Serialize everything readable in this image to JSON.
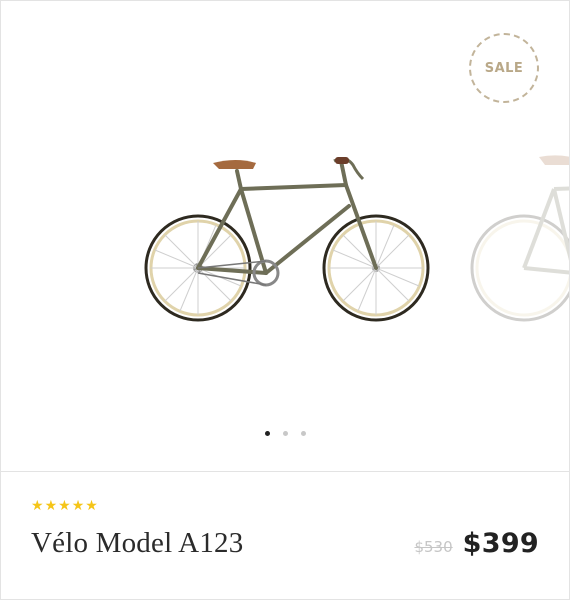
{
  "product": {
    "badge": "SALE",
    "rating_stars": [
      "★",
      "★",
      "★",
      "★",
      "★"
    ],
    "rating_value": 5,
    "name": "Vélo Model A123",
    "old_price": "$530",
    "price": "$399"
  },
  "gallery": {
    "slides_visible_hint": "next-slide-peek",
    "active_slide": 1,
    "slide_count": 3
  },
  "colors": {
    "frame": "#6e6e57",
    "saddle": "#a56a3f",
    "badge": "#b9a888",
    "star": "#f5c518"
  }
}
